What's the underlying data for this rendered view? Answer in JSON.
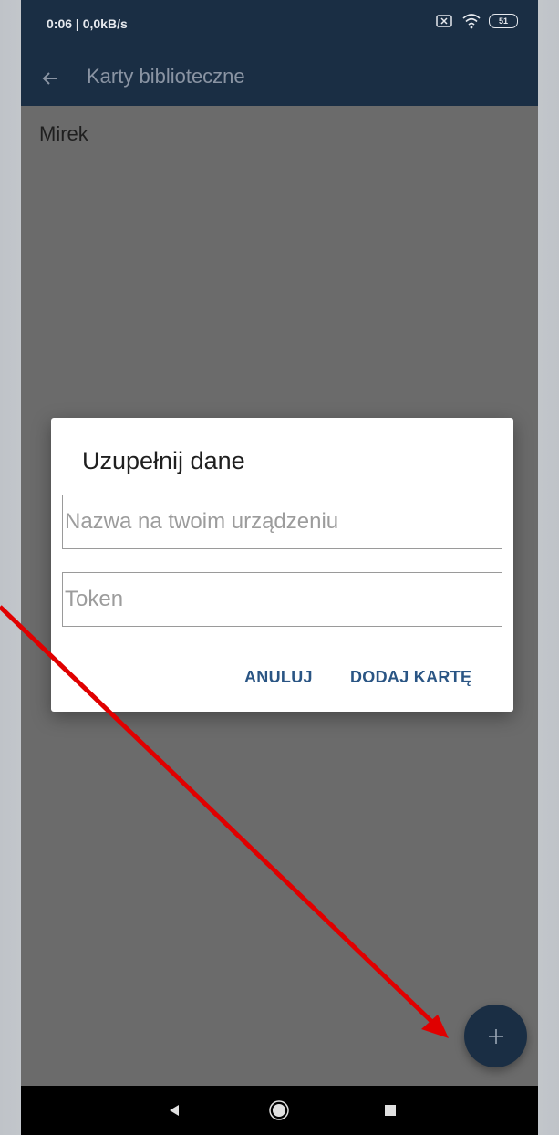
{
  "status_bar": {
    "time_speed": "0:06 | 0,0kB/s",
    "battery_level": "51",
    "icons": [
      "sim-off-icon",
      "wifi-icon",
      "battery-icon"
    ]
  },
  "app_bar": {
    "title": "Karty biblioteczne",
    "back_icon": "arrow-left-icon"
  },
  "list": {
    "items": [
      {
        "label": "Mirek"
      }
    ]
  },
  "dialog": {
    "title": "Uzupełnij dane",
    "name_placeholder": "Nazwa na twoim urządzeniu",
    "token_placeholder": "Token",
    "cancel_label": "ANULUJ",
    "add_label": "DODAJ KARTĘ"
  },
  "fab": {
    "icon": "plus-icon"
  },
  "navigation": {
    "icons": [
      "triangle-back-icon",
      "circle-home-icon",
      "square-recent-icon"
    ]
  },
  "colors": {
    "primary": "#1a2e44",
    "accent_text": "#2a5584",
    "scrim": "#6b6b6b",
    "annotation_arrow": "#e00000"
  }
}
